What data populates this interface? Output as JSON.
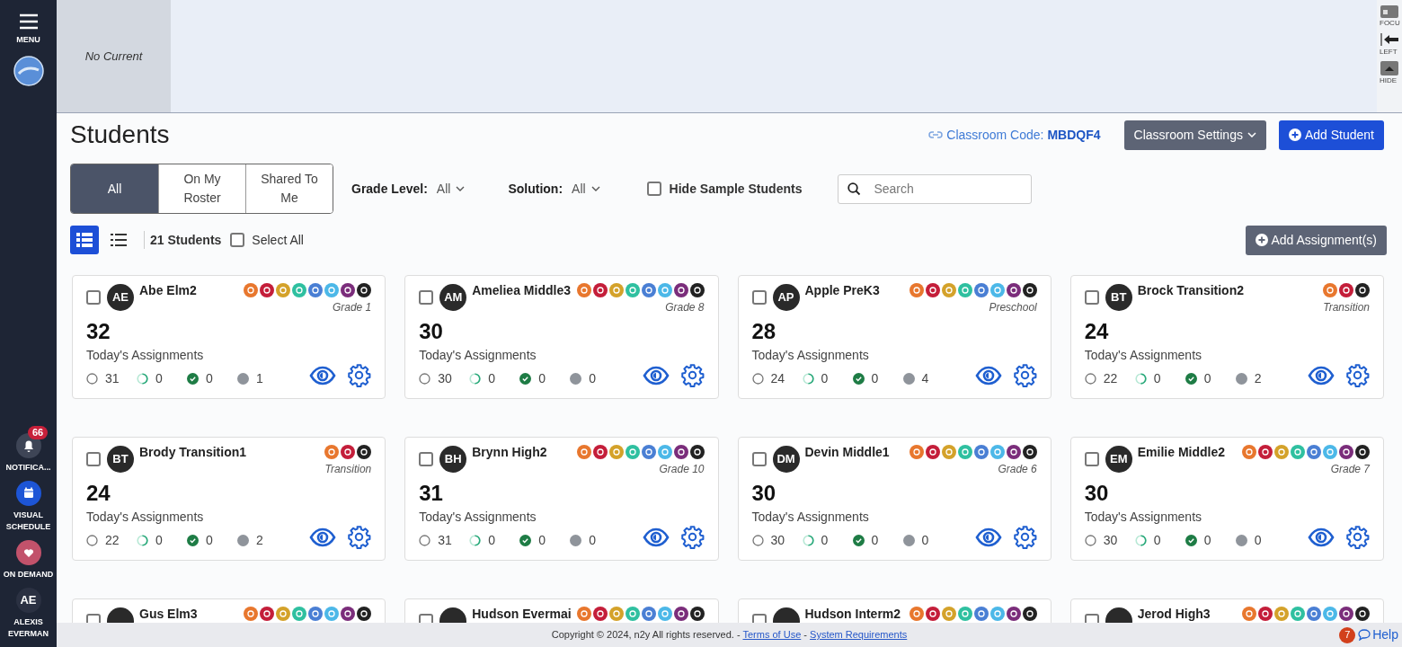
{
  "sidebar": {
    "menu_label": "MENU",
    "items": [
      {
        "kind": "notifications",
        "label": "NOTIFICA...",
        "badge": "66"
      },
      {
        "kind": "schedule",
        "label": "VISUAL SCHEDULE"
      },
      {
        "kind": "demand",
        "label": "ON DEMAND"
      },
      {
        "kind": "user",
        "initials": "AE",
        "label": "ALEXIS EVERMAN"
      }
    ]
  },
  "banner": {
    "current": "No Current",
    "tools": [
      {
        "kind": "focus",
        "label": "FOCU"
      },
      {
        "kind": "left",
        "label": "LEFT"
      },
      {
        "kind": "hide",
        "label": "HIDE"
      }
    ]
  },
  "header": {
    "title": "Students",
    "classroom_code_label": "Classroom Code:",
    "classroom_code": "MBDQF4",
    "settings_button": "Classroom Settings",
    "add_button": "Add Student"
  },
  "tabs": [
    {
      "label": "All",
      "selected": true
    },
    {
      "label": "On My Roster",
      "selected": false
    },
    {
      "label": "Shared To Me",
      "selected": false
    }
  ],
  "filters": [
    {
      "label": "Grade Level:",
      "value": "All"
    },
    {
      "label": "Solution:",
      "value": "All"
    }
  ],
  "hide_sample": {
    "label": "Hide Sample Students",
    "checked": false
  },
  "search": {
    "placeholder": "Search"
  },
  "views": [
    {
      "kind": "grid",
      "selected": true
    },
    {
      "kind": "list",
      "selected": false
    }
  ],
  "student_count": "21 Students",
  "select_all": {
    "label": "Select All",
    "checked": false
  },
  "add_assignment_button": "Add Assignment(s)",
  "students": [
    {
      "initials": "AE",
      "name": "Abe Elm2",
      "grade": "Grade 1",
      "solutions": [
        {
          "color": "#e8772e"
        },
        {
          "color": "#c41e3a"
        },
        {
          "color": "#d4a22a"
        },
        {
          "color": "#2fc0a0"
        },
        {
          "color": "#4a7fd4"
        },
        {
          "color": "#4cb8e8"
        },
        {
          "color": "#7b2d7b"
        },
        {
          "color": "#222222"
        }
      ],
      "total": "32",
      "total_label": "Today's Assignments",
      "stats": [
        "31",
        "0",
        "0",
        "1"
      ],
      "checked": false
    },
    {
      "initials": "AM",
      "name": "Ameliea Middle3",
      "grade": "Grade 8",
      "solutions": [
        {
          "color": "#e8772e"
        },
        {
          "color": "#c41e3a"
        },
        {
          "color": "#d4a22a"
        },
        {
          "color": "#2fc0a0"
        },
        {
          "color": "#4a7fd4"
        },
        {
          "color": "#4cb8e8"
        },
        {
          "color": "#7b2d7b"
        },
        {
          "color": "#222222"
        }
      ],
      "total": "30",
      "total_label": "Today's Assignments",
      "stats": [
        "30",
        "0",
        "0",
        "0"
      ],
      "checked": false
    },
    {
      "initials": "AP",
      "name": "Apple PreK3",
      "grade": "Preschool",
      "solutions": [
        {
          "color": "#e8772e"
        },
        {
          "color": "#c41e3a"
        },
        {
          "color": "#d4a22a"
        },
        {
          "color": "#2fc0a0"
        },
        {
          "color": "#4a7fd4"
        },
        {
          "color": "#4cb8e8"
        },
        {
          "color": "#7b2d7b"
        },
        {
          "color": "#222222"
        }
      ],
      "total": "28",
      "total_label": "Today's Assignments",
      "stats": [
        "24",
        "0",
        "0",
        "4"
      ],
      "checked": false
    },
    {
      "initials": "BT",
      "name": "Brock Transition2",
      "grade": "Transition",
      "solutions": [
        {
          "color": "#e8772e"
        },
        {
          "color": "#c41e3a"
        },
        {
          "color": "#222222"
        }
      ],
      "total": "24",
      "total_label": "Today's Assignments",
      "stats": [
        "22",
        "0",
        "0",
        "2"
      ],
      "checked": false
    },
    {
      "initials": "BT",
      "name": "Brody Transition1",
      "grade": "Transition",
      "solutions": [
        {
          "color": "#e8772e"
        },
        {
          "color": "#c41e3a"
        },
        {
          "color": "#222222"
        }
      ],
      "total": "24",
      "total_label": "Today's Assignments",
      "stats": [
        "22",
        "0",
        "0",
        "2"
      ],
      "checked": false
    },
    {
      "initials": "BH",
      "name": "Brynn High2",
      "grade": "Grade 10",
      "solutions": [
        {
          "color": "#e8772e"
        },
        {
          "color": "#c41e3a"
        },
        {
          "color": "#d4a22a"
        },
        {
          "color": "#2fc0a0"
        },
        {
          "color": "#4a7fd4"
        },
        {
          "color": "#4cb8e8"
        },
        {
          "color": "#7b2d7b"
        },
        {
          "color": "#222222"
        }
      ],
      "total": "31",
      "total_label": "Today's Assignments",
      "stats": [
        "31",
        "0",
        "0",
        "0"
      ],
      "checked": false
    },
    {
      "initials": "DM",
      "name": "Devin Middle1",
      "grade": "Grade 6",
      "solutions": [
        {
          "color": "#e8772e"
        },
        {
          "color": "#c41e3a"
        },
        {
          "color": "#d4a22a"
        },
        {
          "color": "#2fc0a0"
        },
        {
          "color": "#4a7fd4"
        },
        {
          "color": "#4cb8e8"
        },
        {
          "color": "#7b2d7b"
        },
        {
          "color": "#222222"
        }
      ],
      "total": "30",
      "total_label": "Today's Assignments",
      "stats": [
        "30",
        "0",
        "0",
        "0"
      ],
      "checked": false
    },
    {
      "initials": "EM",
      "name": "Emilie Middle2",
      "grade": "Grade 7",
      "solutions": [
        {
          "color": "#e8772e"
        },
        {
          "color": "#c41e3a"
        },
        {
          "color": "#d4a22a"
        },
        {
          "color": "#2fc0a0"
        },
        {
          "color": "#4a7fd4"
        },
        {
          "color": "#4cb8e8"
        },
        {
          "color": "#7b2d7b"
        },
        {
          "color": "#222222"
        }
      ],
      "total": "30",
      "total_label": "Today's Assignments",
      "stats": [
        "30",
        "0",
        "0",
        "0"
      ],
      "checked": false
    },
    {
      "name": "Gus Elm3",
      "solutions": [
        {
          "color": "#e8772e"
        },
        {
          "color": "#c41e3a"
        },
        {
          "color": "#d4a22a"
        },
        {
          "color": "#2fc0a0"
        },
        {
          "color": "#4a7fd4"
        },
        {
          "color": "#4cb8e8"
        },
        {
          "color": "#7b2d7b"
        },
        {
          "color": "#222222"
        }
      ],
      "checked": false
    },
    {
      "name": "Hudson Evermai",
      "solutions": [
        {
          "color": "#e8772e"
        },
        {
          "color": "#c41e3a"
        },
        {
          "color": "#d4a22a"
        },
        {
          "color": "#2fc0a0"
        },
        {
          "color": "#4a7fd4"
        },
        {
          "color": "#4cb8e8"
        },
        {
          "color": "#7b2d7b"
        },
        {
          "color": "#222222"
        }
      ],
      "checked": false
    },
    {
      "name": "Hudson Interm2",
      "solutions": [
        {
          "color": "#e8772e"
        },
        {
          "color": "#c41e3a"
        },
        {
          "color": "#d4a22a"
        },
        {
          "color": "#2fc0a0"
        },
        {
          "color": "#4a7fd4"
        },
        {
          "color": "#4cb8e8"
        },
        {
          "color": "#7b2d7b"
        },
        {
          "color": "#222222"
        }
      ],
      "checked": false
    },
    {
      "name": "Jerod High3",
      "solutions": [
        {
          "color": "#e8772e"
        },
        {
          "color": "#c41e3a"
        },
        {
          "color": "#d4a22a"
        },
        {
          "color": "#2fc0a0"
        },
        {
          "color": "#4a7fd4"
        },
        {
          "color": "#4cb8e8"
        },
        {
          "color": "#7b2d7b"
        },
        {
          "color": "#222222"
        }
      ],
      "checked": false
    }
  ],
  "footer": {
    "copyright": "Copyright © 2024, n2y All rights reserved. -",
    "links": [
      "Terms of Use",
      "System Requirements"
    ],
    "separator": "-",
    "help_badge": "7",
    "help": "Help"
  }
}
